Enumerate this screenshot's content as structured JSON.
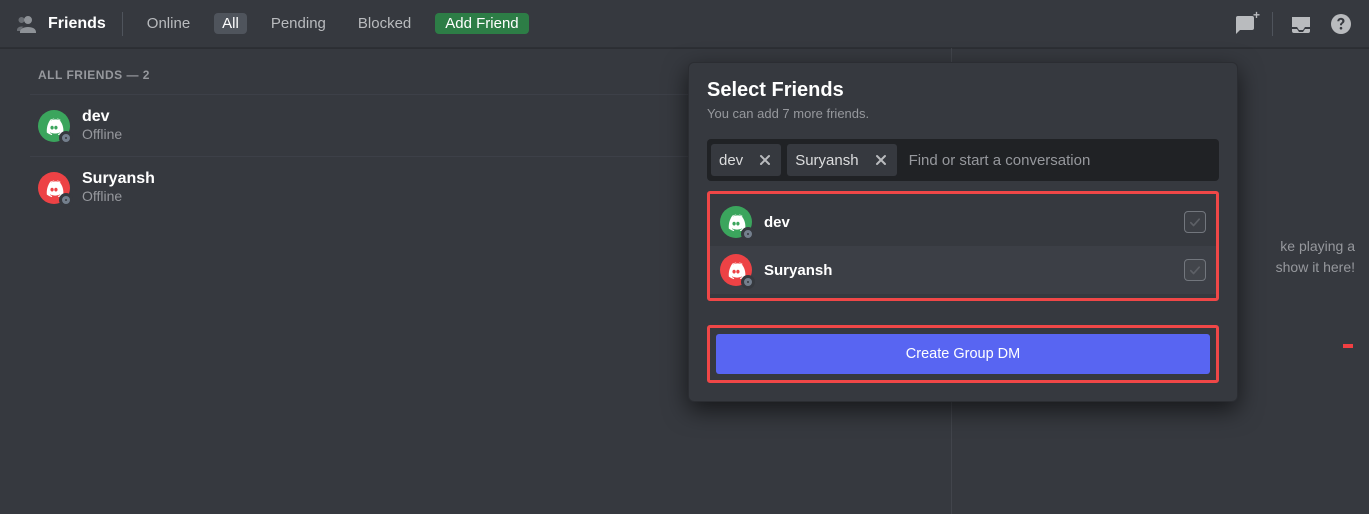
{
  "toolbar": {
    "title": "Friends",
    "tabs": {
      "online": "Online",
      "all": "All",
      "pending": "Pending",
      "blocked": "Blocked",
      "add": "Add Friend"
    }
  },
  "friends": {
    "section_title": "ALL FRIENDS — 2",
    "list": [
      {
        "name": "dev",
        "status": "Offline",
        "color": "green"
      },
      {
        "name": "Suryansh",
        "status": "Offline",
        "color": "red"
      }
    ]
  },
  "activity": {
    "line1": "ke playing a",
    "line2": "show it here!"
  },
  "popover": {
    "title": "Select Friends",
    "subtitle": "You can add 7 more friends.",
    "chips": [
      {
        "label": "dev"
      },
      {
        "label": "Suryansh"
      }
    ],
    "search_placeholder": "Find or start a conversation",
    "options": [
      {
        "name": "dev",
        "color": "green"
      },
      {
        "name": "Suryansh",
        "color": "red"
      }
    ],
    "create_label": "Create Group DM"
  }
}
